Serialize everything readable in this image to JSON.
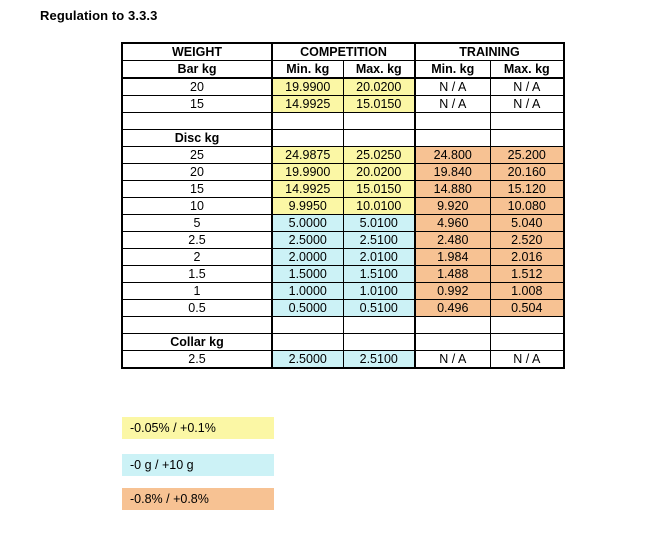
{
  "page": {
    "title": "Regulation to 3.3.3"
  },
  "table": {
    "group_headers": {
      "weight": "WEIGHT",
      "competition": "COMPETITION",
      "training": "TRAINING"
    },
    "sub_headers": {
      "weight": "Bar kg",
      "competition_min": "Min. kg",
      "competition_max": "Max. kg",
      "training_min": "Min. kg",
      "training_max": "Max. kg"
    },
    "na_label": "N / A",
    "sections": [
      {
        "label": "Bar kg",
        "label_is_header_row": false,
        "rows": [
          {
            "weight": "20",
            "competition_min": "19.9900",
            "competition_max": "20.0200",
            "training_min": "N / A",
            "training_max": "N / A",
            "competition_fill": "yellow",
            "training_fill": "none"
          },
          {
            "weight": "15",
            "competition_min": "14.9925",
            "competition_max": "15.0150",
            "training_min": "N / A",
            "training_max": "N / A",
            "competition_fill": "yellow",
            "training_fill": "none"
          }
        ]
      },
      {
        "label": "Disc kg",
        "label_is_header_row": true,
        "rows": [
          {
            "weight": "25",
            "competition_min": "24.9875",
            "competition_max": "25.0250",
            "training_min": "24.800",
            "training_max": "25.200",
            "competition_fill": "yellow",
            "training_fill": "orange"
          },
          {
            "weight": "20",
            "competition_min": "19.9900",
            "competition_max": "20.0200",
            "training_min": "19.840",
            "training_max": "20.160",
            "competition_fill": "yellow",
            "training_fill": "orange"
          },
          {
            "weight": "15",
            "competition_min": "14.9925",
            "competition_max": "15.0150",
            "training_min": "14.880",
            "training_max": "15.120",
            "competition_fill": "yellow",
            "training_fill": "orange"
          },
          {
            "weight": "10",
            "competition_min": "9.9950",
            "competition_max": "10.0100",
            "training_min": "9.920",
            "training_max": "10.080",
            "competition_fill": "yellow",
            "training_fill": "orange"
          },
          {
            "weight": "5",
            "competition_min": "5.0000",
            "competition_max": "5.0100",
            "training_min": "4.960",
            "training_max": "5.040",
            "competition_fill": "cyan",
            "training_fill": "orange"
          },
          {
            "weight": "2.5",
            "competition_min": "2.5000",
            "competition_max": "2.5100",
            "training_min": "2.480",
            "training_max": "2.520",
            "competition_fill": "cyan",
            "training_fill": "orange"
          },
          {
            "weight": "2",
            "competition_min": "2.0000",
            "competition_max": "2.0100",
            "training_min": "1.984",
            "training_max": "2.016",
            "competition_fill": "cyan",
            "training_fill": "orange"
          },
          {
            "weight": "1.5",
            "competition_min": "1.5000",
            "competition_max": "1.5100",
            "training_min": "1.488",
            "training_max": "1.512",
            "competition_fill": "cyan",
            "training_fill": "orange"
          },
          {
            "weight": "1",
            "competition_min": "1.0000",
            "competition_max": "1.0100",
            "training_min": "0.992",
            "training_max": "1.008",
            "competition_fill": "cyan",
            "training_fill": "orange"
          },
          {
            "weight": "0.5",
            "competition_min": "0.5000",
            "competition_max": "0.5100",
            "training_min": "0.496",
            "training_max": "0.504",
            "competition_fill": "cyan",
            "training_fill": "orange"
          }
        ]
      },
      {
        "label": "Collar kg",
        "label_is_header_row": true,
        "rows": [
          {
            "weight": "2.5",
            "competition_min": "2.5000",
            "competition_max": "2.5100",
            "training_min": "N / A",
            "training_max": "N / A",
            "competition_fill": "cyan",
            "training_fill": "none"
          }
        ]
      }
    ]
  },
  "legend": [
    {
      "key": "yellow",
      "label": "-0.05% / +0.1%",
      "color": "#fbf7a5"
    },
    {
      "key": "cyan",
      "label": "-0 g / +10 g",
      "color": "#ccf2f6"
    },
    {
      "key": "orange",
      "label": "-0.8% / +0.8%",
      "color": "#f7c293"
    }
  ]
}
